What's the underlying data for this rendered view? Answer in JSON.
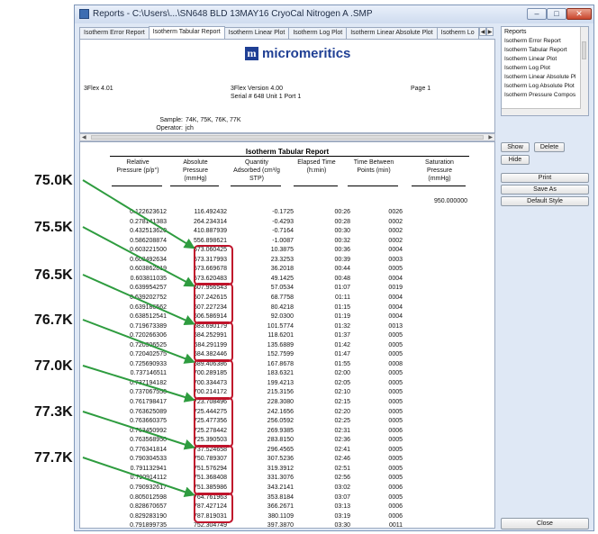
{
  "window": {
    "title": "Reports - C:\\Users\\...\\SN648 BLD 13MAY16 CryoCal Nitrogen A .SMP",
    "minimize": "–",
    "maximize": "□",
    "close": "✕"
  },
  "tabs": [
    "Isotherm Error Report",
    "Isotherm Tabular Report",
    "Isotherm Linear Plot",
    "Isotherm Log Plot",
    "Isotherm Linear Absolute Plot",
    "Isotherm Lo"
  ],
  "header": {
    "brand": "micromeritics",
    "brand_mark": "m",
    "software": "3Flex 4.01",
    "version": "3Flex Version 4.00",
    "serial": "Serial # 648  Unit 1  Port 1",
    "page": "Page 1",
    "sample_label": "Sample:",
    "sample_value": "74K, 75K, 76K, 77K",
    "operator_label": "Operator:",
    "operator_value": "jch"
  },
  "table": {
    "title": "Isotherm Tabular Report",
    "headers": [
      [
        "Relative",
        "Pressure (p/p°)"
      ],
      [
        "Absolute",
        "Pressure",
        "(mmHg)"
      ],
      [
        "Quantity",
        "Adsorbed (cm³/g",
        "STP)"
      ],
      [
        "Elapsed Time",
        "(h:min)"
      ],
      [
        "Time Between",
        "Points (min)"
      ],
      [
        "Saturation",
        "Pressure",
        "(mmHg)"
      ]
    ],
    "saturation_value": "950.000000",
    "rows": [
      [
        "0.122623612",
        "116.492432",
        "-0.1725",
        "00:26",
        "0026"
      ],
      [
        "0.278141383",
        "264.234314",
        "-0.4293",
        "00:28",
        "0002"
      ],
      [
        "0.432513620",
        "410.887939",
        "-0.7164",
        "00:30",
        "0002"
      ],
      [
        "0.586208874",
        "556.898621",
        "-1.0087",
        "00:32",
        "0002"
      ],
      [
        "0.603221500",
        "573.060425",
        "10.3875",
        "00:36",
        "0004"
      ],
      [
        "0.603492634",
        "573.317993",
        "23.3253",
        "00:39",
        "0003"
      ],
      [
        "0.603862819",
        "573.669678",
        "36.2018",
        "00:44",
        "0005"
      ],
      [
        "0.603811035",
        "573.620483",
        "49.1425",
        "00:48",
        "0004"
      ],
      [
        "0.639954257",
        "607.956543",
        "57.0534",
        "01:07",
        "0019"
      ],
      [
        "0.639202752",
        "607.242615",
        "68.7758",
        "01:11",
        "0004"
      ],
      [
        "0.639186562",
        "607.227234",
        "80.4218",
        "01:15",
        "0004"
      ],
      [
        "0.638512541",
        "606.586914",
        "92.0300",
        "01:19",
        "0004"
      ],
      [
        "0.719673389",
        "683.690179",
        "101.5774",
        "01:32",
        "0013"
      ],
      [
        "0.720266306",
        "684.252991",
        "118.6201",
        "01:37",
        "0005"
      ],
      [
        "0.720306525",
        "684.291199",
        "135.6889",
        "01:42",
        "0005"
      ],
      [
        "0.720402575",
        "684.382446",
        "152.7599",
        "01:47",
        "0005"
      ],
      [
        "0.725690933",
        "689.406386",
        "167.8678",
        "01:55",
        "0008"
      ],
      [
        "0.737146511",
        "700.289185",
        "183.6321",
        "02:00",
        "0005"
      ],
      [
        "0.737194182",
        "700.334473",
        "199.4213",
        "02:05",
        "0005"
      ],
      [
        "0.737067550",
        "700.214172",
        "215.3156",
        "02:10",
        "0005"
      ],
      [
        "0.761798417",
        "723.708496",
        "228.3080",
        "02:15",
        "0005"
      ],
      [
        "0.763625089",
        "725.444275",
        "242.1656",
        "02:20",
        "0005"
      ],
      [
        "0.763660375",
        "725.477356",
        "256.0592",
        "02:25",
        "0005"
      ],
      [
        "0.763450992",
        "725.278442",
        "269.9385",
        "02:31",
        "0006"
      ],
      [
        "0.763568950",
        "725.390503",
        "283.8150",
        "02:36",
        "0005"
      ],
      [
        "0.776341814",
        "737.524658",
        "296.4565",
        "02:41",
        "0005"
      ],
      [
        "0.790304533",
        "750.789307",
        "307.5236",
        "02:46",
        "0005"
      ],
      [
        "0.791132941",
        "751.576294",
        "319.3912",
        "02:51",
        "0005"
      ],
      [
        "0.790914112",
        "751.368408",
        "331.3076",
        "02:56",
        "0005"
      ],
      [
        "0.790932617",
        "751.385986",
        "343.2141",
        "03:02",
        "0006"
      ],
      [
        "0.805012598",
        "764.761963",
        "353.8184",
        "03:07",
        "0005"
      ],
      [
        "0.828670657",
        "787.427124",
        "366.2671",
        "03:13",
        "0006"
      ],
      [
        "0.829283190",
        "787.819031",
        "380.1109",
        "03:19",
        "0006"
      ],
      [
        "0.791899735",
        "752.304749",
        "397.3870",
        "03:30",
        "0011"
      ]
    ]
  },
  "callouts": [
    "75.0K",
    "75.5K",
    "76.5K",
    "76.7K",
    "77.0K",
    "77.3K",
    "77.7K"
  ],
  "sidebar": {
    "list_header": "Reports",
    "items": [
      "Isotherm Error Report",
      "Isotherm Tabular Report",
      "Isotherm Linear Plot",
      "Isotherm Log Plot",
      "Isotherm Linear Absolute Pl",
      "Isotherm Log Absolute Plot",
      "Isotherm Pressure Compos"
    ],
    "show": "Show",
    "delete": "Delete",
    "hide": "Hide",
    "print": "Print",
    "save_as": "Save As",
    "default_style": "Default Style",
    "close": "Close"
  },
  "colors": {
    "highlight": "#c0142b",
    "arrow": "#2e9c3f",
    "brand": "#1f3f94"
  }
}
